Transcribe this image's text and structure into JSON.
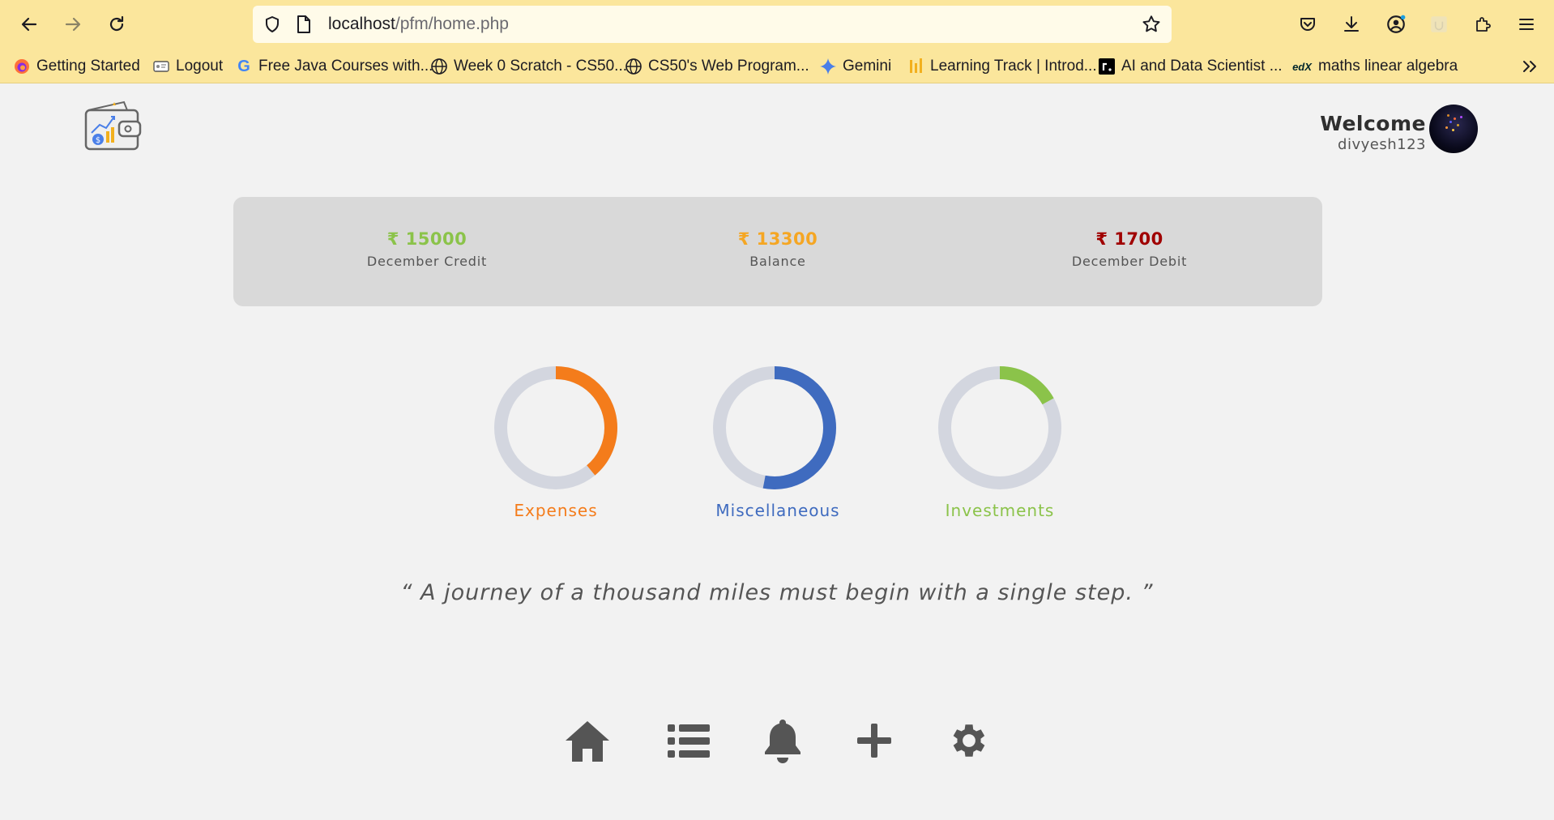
{
  "browser": {
    "url_host": "localhost",
    "url_path": "/pfm/home.php",
    "bookmarks": [
      {
        "label": "Getting Started",
        "icon": "firefox-icon"
      },
      {
        "label": "Logout",
        "icon": "page-icon"
      },
      {
        "label": "Free Java Courses with...",
        "icon": "google-icon"
      },
      {
        "label": "Week 0 Scratch - CS50...",
        "icon": "globe-icon"
      },
      {
        "label": "CS50's Web Program...",
        "icon": "globe-icon"
      },
      {
        "label": "Gemini",
        "icon": "gemini-icon"
      },
      {
        "label": "Learning Track | Introd...",
        "icon": "bars-icon"
      },
      {
        "label": "AI and Data Scientist ...",
        "icon": "roadmap-icon"
      },
      {
        "label": "maths linear algebra",
        "icon": "edx-icon"
      }
    ]
  },
  "header": {
    "welcome": "Welcome",
    "username": "divyesh123"
  },
  "summary": {
    "credit": {
      "value": "₹ 15000",
      "label": "December Credit",
      "color": "#8bc34a"
    },
    "balance": {
      "value": "₹ 13300",
      "label": "Balance",
      "color": "#f5a623"
    },
    "debit": {
      "value": "₹ 1700",
      "label": "December Debit",
      "color": "#a00000"
    }
  },
  "charts": [
    {
      "label": "Expenses",
      "fraction": 0.39,
      "color": "#f47c1b"
    },
    {
      "label": "Miscellaneous",
      "fraction": 0.53,
      "color": "#3f6bbf"
    },
    {
      "label": "Investments",
      "fraction": 0.17,
      "color": "#8bc34a"
    }
  ],
  "quote": "“ A journey of a thousand miles must begin with a single step. ”",
  "bottom_nav": [
    "home-icon",
    "list-icon",
    "bell-icon",
    "plus-icon",
    "gear-icon"
  ]
}
